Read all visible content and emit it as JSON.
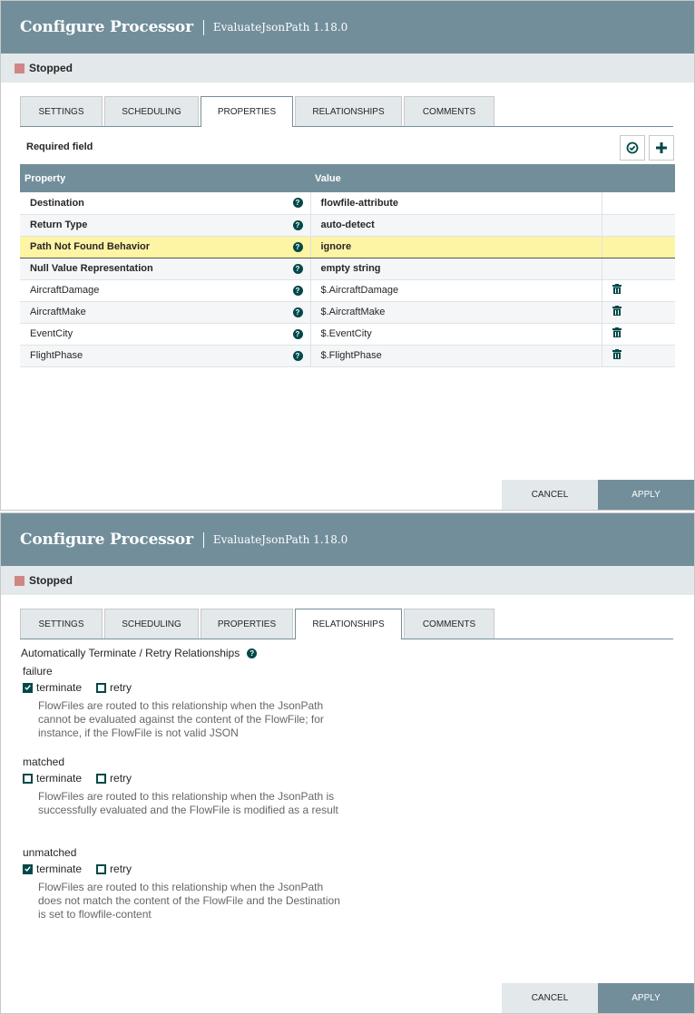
{
  "dialog1": {
    "title": "Configure Processor",
    "subtitle": "EvaluateJsonPath 1.18.0",
    "status": "Stopped",
    "tabs": [
      "SETTINGS",
      "SCHEDULING",
      "PROPERTIES",
      "RELATIONSHIPS",
      "COMMENTS"
    ],
    "active_tab": "PROPERTIES",
    "required_label": "Required field",
    "columns": [
      "Property",
      "Value"
    ],
    "rows": [
      {
        "name": "Destination",
        "value": "flowfile-attribute",
        "required": true,
        "deletable": false
      },
      {
        "name": "Return Type",
        "value": "auto-detect",
        "required": true,
        "deletable": false
      },
      {
        "name": "Path Not Found Behavior",
        "value": "ignore",
        "required": true,
        "deletable": false
      },
      {
        "name": "Null Value Representation",
        "value": "empty string",
        "required": true,
        "deletable": false
      },
      {
        "name": "AircraftDamage",
        "value": "$.AircraftDamage",
        "required": false,
        "deletable": true
      },
      {
        "name": "AircraftMake",
        "value": "$.AircraftMake",
        "required": false,
        "deletable": true
      },
      {
        "name": "EventCity",
        "value": "$.EventCity",
        "required": false,
        "deletable": true
      },
      {
        "name": "FlightPhase",
        "value": "$.FlightPhase",
        "required": false,
        "deletable": true
      }
    ],
    "cancel": "CANCEL",
    "apply": "APPLY"
  },
  "dialog2": {
    "title": "Configure Processor",
    "subtitle": "EvaluateJsonPath 1.18.0",
    "status": "Stopped",
    "tabs": [
      "SETTINGS",
      "SCHEDULING",
      "PROPERTIES",
      "RELATIONSHIPS",
      "COMMENTS"
    ],
    "active_tab": "RELATIONSHIPS",
    "auto_label": "Automatically Terminate / Retry Relationships",
    "terminate_label": "terminate",
    "retry_label": "retry",
    "relationships": [
      {
        "name": "failure",
        "terminate": true,
        "retry": false,
        "desc": "FlowFiles are routed to this relationship when the JsonPath cannot be evaluated against the content of the FlowFile; for instance, if the FlowFile is not valid JSON"
      },
      {
        "name": "matched",
        "terminate": false,
        "retry": false,
        "desc": "FlowFiles are routed to this relationship when the JsonPath is successfully evaluated and the FlowFile is modified as a result"
      },
      {
        "name": "unmatched",
        "terminate": true,
        "retry": false,
        "desc": "FlowFiles are routed to this relationship when the JsonPath does not match the content of the FlowFile and the Destination is set to flowfile-content"
      }
    ],
    "cancel": "CANCEL",
    "apply": "APPLY"
  }
}
